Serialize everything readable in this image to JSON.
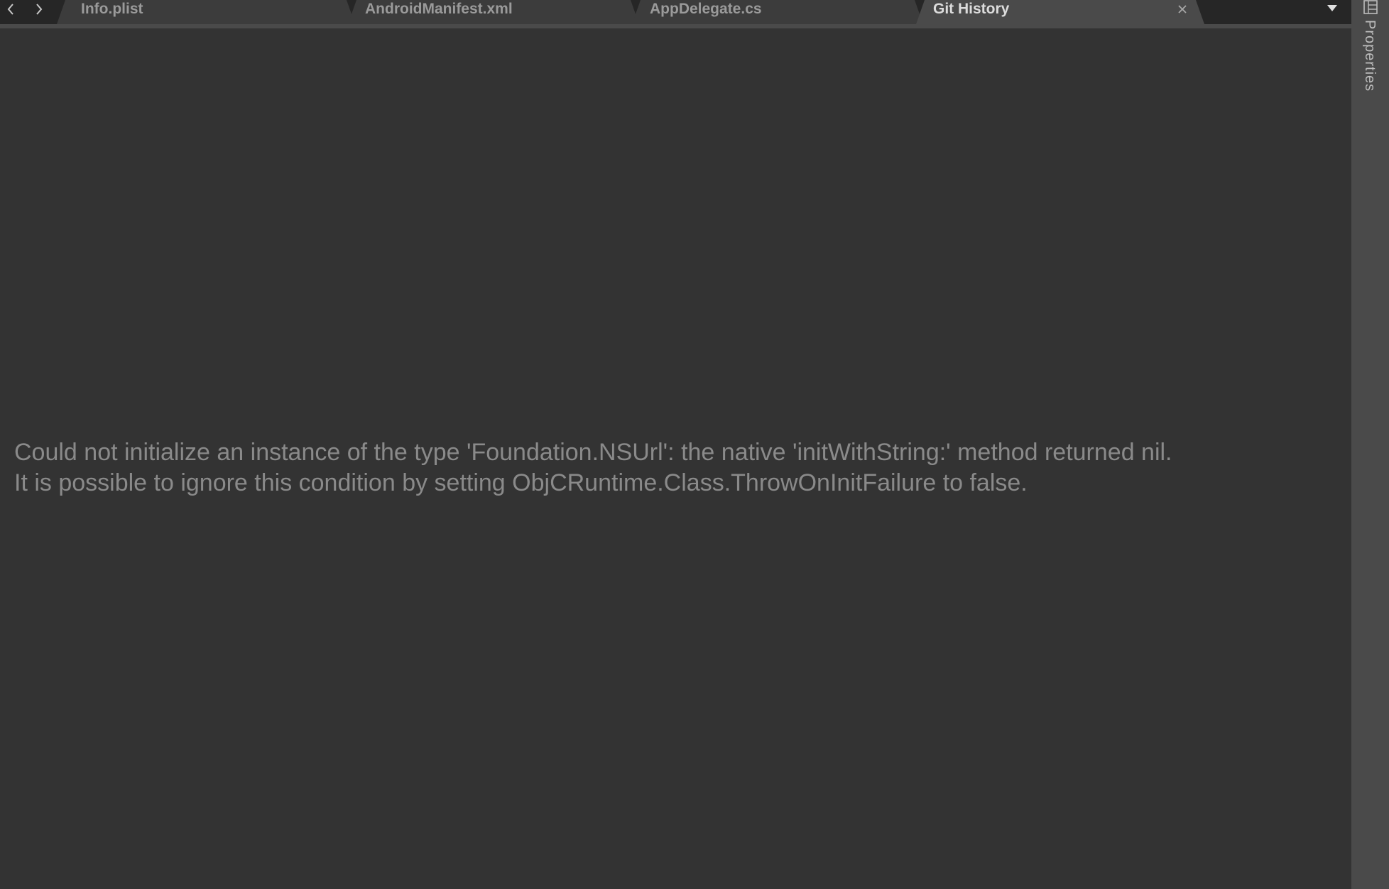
{
  "tabs": [
    {
      "label": "Info.plist"
    },
    {
      "label": "AndroidManifest.xml"
    },
    {
      "label": "AppDelegate.cs"
    },
    {
      "label": "Git History",
      "active": true
    }
  ],
  "nav": {
    "back_icon": "chevron-left-icon",
    "forward_icon": "chevron-right-icon"
  },
  "sidebar": {
    "properties_label": "Properties",
    "properties_icon": "properties-panel-icon"
  },
  "error": {
    "line1": "Could not initialize an instance of the type 'Foundation.NSUrl': the native 'initWithString:' method returned nil.",
    "line2": "It is possible to ignore this condition by setting ObjCRuntime.Class.ThrowOnInitFailure to false."
  },
  "colors": {
    "background": "#333333",
    "tabbar": "#262626",
    "tab_inactive": "#3c3c3c",
    "tab_active": "#4a4a4a",
    "message_text": "#8a8a8a"
  }
}
